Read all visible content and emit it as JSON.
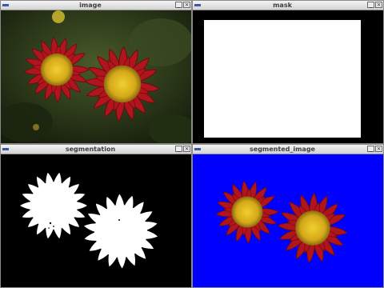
{
  "windows": {
    "image": {
      "title": "image"
    },
    "mask": {
      "title": "mask"
    },
    "segmentation": {
      "title": "segmentation"
    },
    "segmented_image": {
      "title": "segmented_image"
    }
  },
  "controls": {
    "minimize_glyph": "_",
    "close_glyph": "×"
  },
  "colors": {
    "desktop_bg": "#b4b4b4",
    "mask_black": "#000000",
    "mask_white": "#ffffff",
    "segmented_bg": "#0000ff",
    "petal_red": "#b4141c",
    "flower_center": "#e0c020",
    "foliage": "#2c3a1c"
  }
}
